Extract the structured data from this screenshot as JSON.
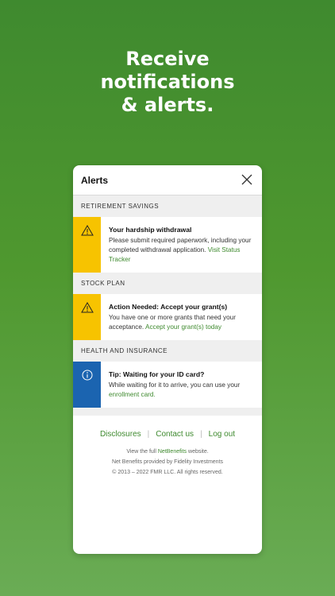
{
  "headline": {
    "line1": "Receive",
    "line2": "notifications",
    "line3": "& alerts."
  },
  "modal": {
    "title": "Alerts",
    "close_icon": "close-icon"
  },
  "sections": [
    {
      "label": "RETIREMENT SAVINGS",
      "alert": {
        "type": "warning",
        "icon": "warning-icon",
        "title": "Your hardship withdrawal",
        "text": "Please submit required paperwork, including your completed withdrawal application. ",
        "link": "Visit Status Tracker"
      }
    },
    {
      "label": "STOCK PLAN",
      "alert": {
        "type": "warning",
        "icon": "warning-icon",
        "title": "Action Needed: Accept your grant(s)",
        "text": "You have one or more grants that need your acceptance. ",
        "link": "Accept your grant(s) today"
      }
    },
    {
      "label": "HEALTH AND INSURANCE",
      "alert": {
        "type": "info",
        "icon": "info-icon",
        "title": "Tip: Waiting for your ID card?",
        "text": "While waiting for it to arrive, you can use your ",
        "link": "enrollment card."
      }
    }
  ],
  "footer": {
    "links": [
      "Disclosures",
      "Contact us",
      "Log out"
    ],
    "view_prefix": "View the full ",
    "view_link": "NetBenefits",
    "view_suffix": " website.",
    "provided": "Net Benefits provided by Fidelity Investments",
    "copyright": "© 2013 – 2022 FMR LLC. All rights reserved."
  },
  "colors": {
    "brand_green": "#3f8a2f",
    "warning": "#f7c300",
    "info": "#1b64b0"
  }
}
